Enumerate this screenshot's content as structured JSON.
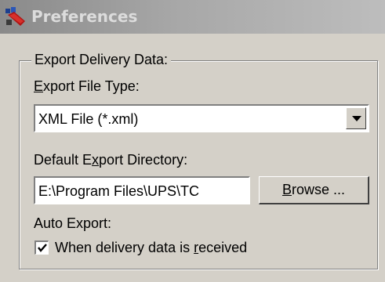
{
  "window": {
    "title": "Preferences"
  },
  "group": {
    "title": "Export Delivery Data:"
  },
  "export_file_type": {
    "label_prefix": "",
    "label_mnemonic": "E",
    "label_rest": "xport File Type:",
    "selected": "XML File (*.xml)"
  },
  "export_directory": {
    "label_prefix": "Default E",
    "label_mnemonic": "x",
    "label_rest": "port Directory:",
    "value": "E:\\Program Files\\UPS\\TC",
    "browse_mnemonic": "B",
    "browse_rest": "rowse ..."
  },
  "auto_export": {
    "label": "Auto Export:",
    "checkbox_prefix": "When delivery data is ",
    "checkbox_mnemonic": "r",
    "checkbox_rest": "eceived",
    "checked": true
  },
  "icons": {
    "app_icon": "preferences-icon",
    "dropdown": "chevron-down-icon",
    "check": "checkmark-icon"
  }
}
